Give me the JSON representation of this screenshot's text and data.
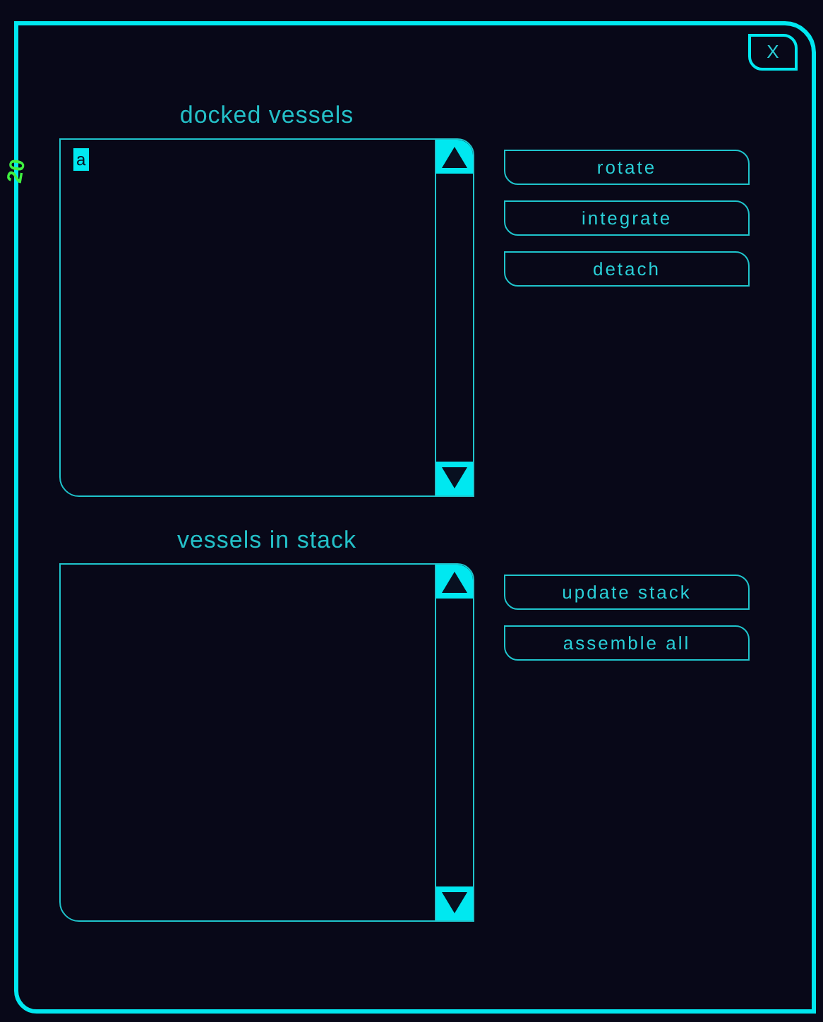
{
  "background_label": "20",
  "window": {
    "close": "X"
  },
  "sections": [
    {
      "title": "docked vessels",
      "items": [
        {
          "label": "a",
          "selected": true
        }
      ],
      "buttons": [
        "rotate",
        "integrate",
        "detach"
      ]
    },
    {
      "title": "vessels in stack",
      "buttons": [
        "update stack",
        "assemble all"
      ]
    }
  ]
}
